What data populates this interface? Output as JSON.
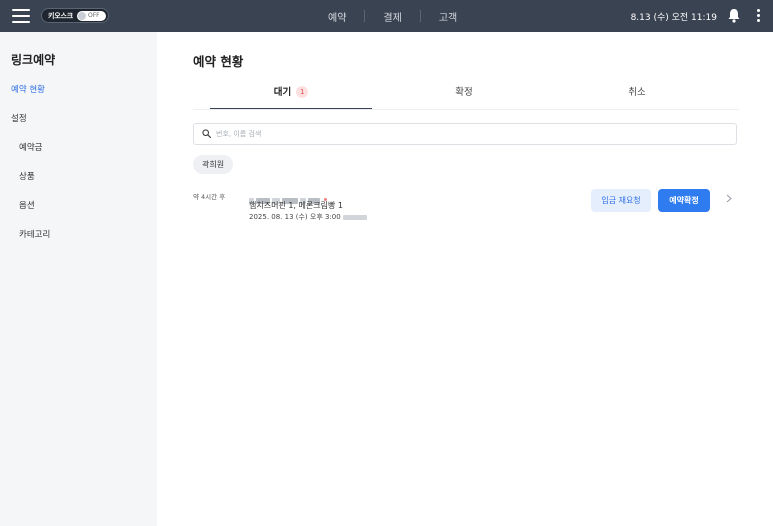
{
  "topbar": {
    "kiosk_label": "키오스크",
    "kiosk_state": "OFF",
    "nav": [
      "예약",
      "결제",
      "고객"
    ],
    "datetime": "8.13 (수) 오전 11:19",
    "icons": [
      "menu-icon",
      "bell-icon",
      "more-vertical-icon"
    ]
  },
  "sidebar": {
    "title": "링크예약",
    "items": [
      "예약 현황",
      "설정",
      "예약금",
      "상품",
      "옵션",
      "카테고리"
    ]
  },
  "main": {
    "title": "예약 현황",
    "tabs": [
      {
        "label": "대기",
        "badge": "1"
      },
      {
        "label": "확정"
      },
      {
        "label": "취소"
      }
    ],
    "search_placeholder": "번호, 이름 검색",
    "chip": "곽희원",
    "reservation": {
      "time_label": "약 4시간 후",
      "items": "햄치즈머핀 1, 메론크림빵 1",
      "datetime": "2025. 08. 13 (수) 오후 3:00",
      "deposit_button": "입금 재요청",
      "confirm_button": "예약확정"
    }
  },
  "colors": {
    "topbar": "#3a4351",
    "accent": "#2f7bf0",
    "active_nav": "#2f6fe4",
    "badge": "#e24a4a"
  }
}
